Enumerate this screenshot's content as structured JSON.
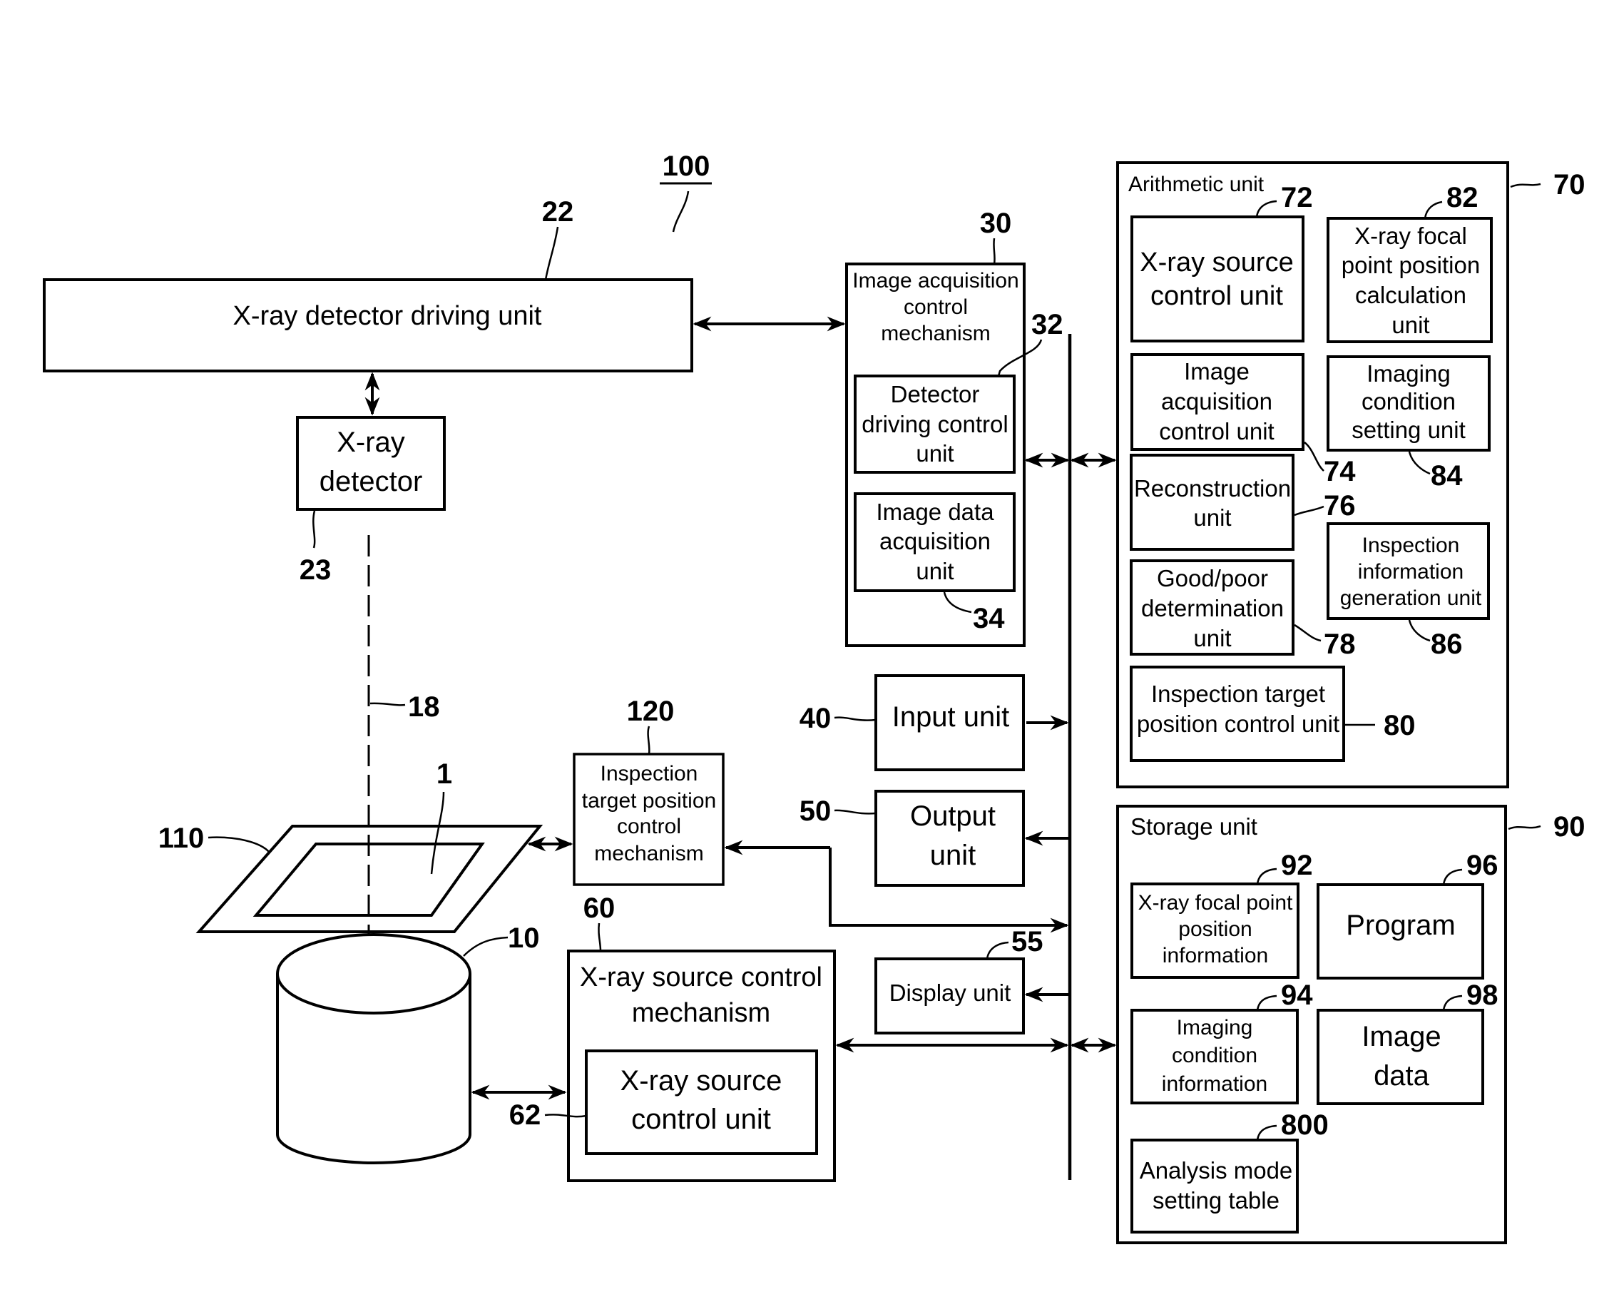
{
  "figure": {
    "system_ref": "100",
    "blocks": {
      "detector_driving_unit": {
        "ref": "22",
        "lines": [
          "X-ray detector driving unit"
        ]
      },
      "xray_detector": {
        "ref": "23",
        "lines": [
          "X-ray",
          "detector"
        ]
      },
      "image_acquisition_mechanism": {
        "ref": "30",
        "lines": [
          "Image acquisition",
          "control",
          "mechanism"
        ]
      },
      "detector_driving_control_unit": {
        "ref": "32",
        "lines": [
          "Detector",
          "driving control",
          "unit"
        ]
      },
      "image_data_acquisition_unit": {
        "ref": "34",
        "lines": [
          "Image data",
          "acquisition",
          "unit"
        ]
      },
      "input_unit": {
        "ref": "40",
        "lines": [
          "Input unit"
        ]
      },
      "output_unit": {
        "ref": "50",
        "lines": [
          "Output",
          "unit"
        ]
      },
      "display_unit": {
        "ref": "55",
        "lines": [
          "Display unit"
        ]
      },
      "xray_source_control_mechanism": {
        "ref": "60",
        "lines": [
          "X-ray source control",
          "mechanism"
        ]
      },
      "xray_source_control_unit_62": {
        "ref": "62",
        "lines": [
          "X-ray source",
          "control unit"
        ]
      },
      "inspection_target_position_mechanism": {
        "ref": "120",
        "lines": [
          "Inspection",
          "target position",
          "control",
          "mechanism"
        ]
      },
      "stage": {
        "ref": "110"
      },
      "inspection_target": {
        "ref": "1"
      },
      "xray_source": {
        "ref": "10"
      },
      "xray_axis": {
        "ref": "18"
      }
    },
    "arithmetic_unit": {
      "ref": "70",
      "title": "Arithmetic unit",
      "children": {
        "u72": {
          "ref": "72",
          "lines": [
            "X-ray source",
            "control unit"
          ]
        },
        "u82": {
          "ref": "82",
          "lines": [
            "X-ray focal",
            "point position",
            "calculation",
            "unit"
          ]
        },
        "u74": {
          "ref": "74",
          "lines": [
            "Image",
            "acquisition",
            "control unit"
          ]
        },
        "u84": {
          "ref": "84",
          "lines": [
            "Imaging",
            "condition",
            "setting unit"
          ]
        },
        "u76": {
          "ref": "76",
          "lines": [
            "Reconstruction",
            "unit"
          ]
        },
        "u86": {
          "ref": "86",
          "lines": [
            "Inspection",
            "information",
            "generation unit"
          ]
        },
        "u78": {
          "ref": "78",
          "lines": [
            "Good/poor",
            "determination",
            "unit"
          ]
        },
        "u80": {
          "ref": "80",
          "lines": [
            "Inspection target",
            "position control unit"
          ]
        }
      }
    },
    "storage_unit": {
      "ref": "90",
      "title": "Storage unit",
      "children": {
        "s92": {
          "ref": "92",
          "lines": [
            "X-ray focal point",
            "position",
            "information"
          ]
        },
        "s96": {
          "ref": "96",
          "lines": [
            "Program"
          ]
        },
        "s94": {
          "ref": "94",
          "lines": [
            "Imaging",
            "condition",
            "information"
          ]
        },
        "s98": {
          "ref": "98",
          "lines": [
            "Image",
            "data"
          ]
        },
        "s800": {
          "ref": "800",
          "lines": [
            "Analysis mode",
            "setting table"
          ]
        }
      }
    }
  }
}
